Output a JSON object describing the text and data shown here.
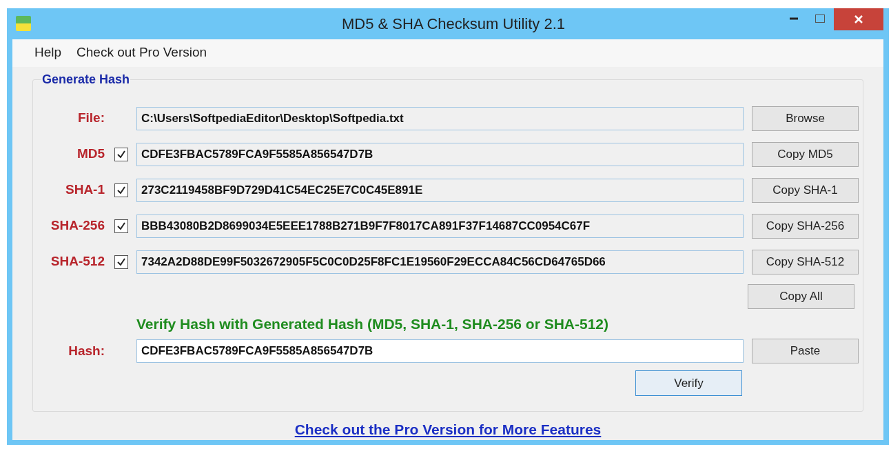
{
  "window": {
    "title": "MD5 & SHA Checksum Utility 2.1"
  },
  "menu": [
    "Help",
    "Check out Pro Version"
  ],
  "generate": {
    "title": "Generate Hash",
    "file": {
      "label": "File:",
      "value": "C:\\Users\\SoftpediaEditor\\Desktop\\Softpedia.txt",
      "button": "Browse"
    },
    "hashes": [
      {
        "label": "MD5",
        "checked": true,
        "value": "CDFE3FBAC5789FCA9F5585A856547D7B",
        "button": "Copy MD5"
      },
      {
        "label": "SHA-1",
        "checked": true,
        "value": "273C2119458BF9D729D41C54EC25E7C0C45E891E",
        "button": "Copy SHA-1"
      },
      {
        "label": "SHA-256",
        "checked": true,
        "value": "BBB43080B2D8699034E5EEE1788B271B9F7F8017CA891F37F14687CC0954C67F",
        "button": "Copy SHA-256"
      },
      {
        "label": "SHA-512",
        "checked": true,
        "value": "7342A2D88DE99F5032672905F5C0C0D25F8FC1E19560F29ECCA84C56CD64765D66",
        "button": "Copy SHA-512"
      }
    ],
    "copy_all": "Copy All"
  },
  "verify": {
    "heading": "Verify Hash with Generated Hash (MD5, SHA-1, SHA-256 or SHA-512)",
    "label": "Hash:",
    "value": "CDFE3FBAC5789FCA9F5585A856547D7B",
    "paste": "Paste",
    "button": "Verify"
  },
  "footer_link": "Check out the Pro Version for More Features"
}
